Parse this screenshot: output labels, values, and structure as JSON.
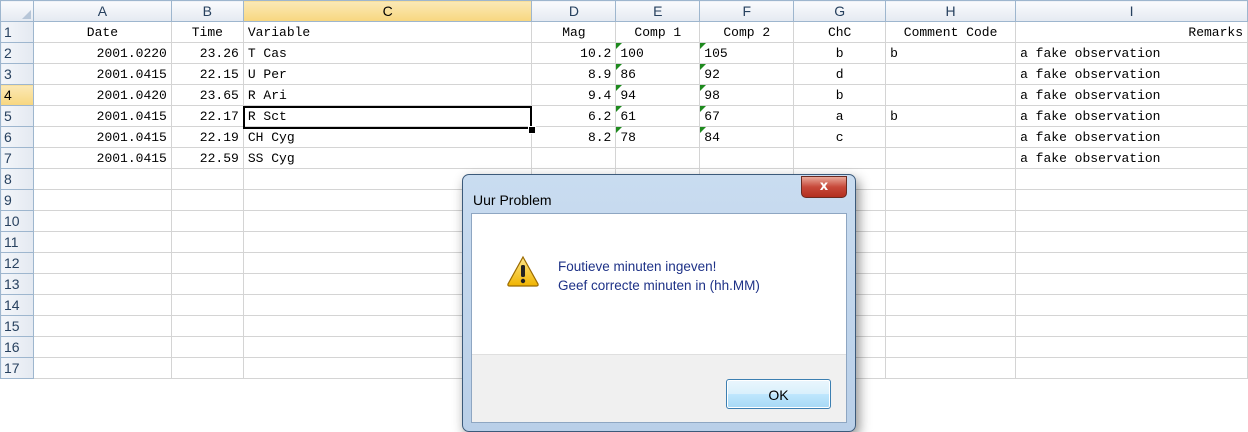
{
  "spreadsheet": {
    "column_letters": [
      "A",
      "B",
      "C",
      "D",
      "E",
      "F",
      "G",
      "H",
      "I"
    ],
    "row_numbers": [
      "1",
      "2",
      "3",
      "4",
      "5",
      "6",
      "7",
      "8",
      "9",
      "10",
      "11",
      "12",
      "13",
      "14",
      "15",
      "16",
      "17"
    ],
    "headers": [
      "Date",
      "Time",
      "Variable",
      "Mag",
      "Comp 1",
      "Comp 2",
      "ChC",
      "Comment Code",
      "Remarks"
    ],
    "rows": [
      [
        "2001.0220",
        "23.26",
        "T Cas",
        "10.2",
        "100",
        "105",
        "b",
        "b",
        "a fake observation"
      ],
      [
        "2001.0415",
        "22.15",
        "U Per",
        "8.9",
        "86",
        "92",
        "d",
        "",
        "a fake observation"
      ],
      [
        "2001.0420",
        "23.65",
        "R Ari",
        "9.4",
        "94",
        "98",
        "b",
        "",
        "a fake observation"
      ],
      [
        "2001.0415",
        "22.17",
        "R Sct",
        "6.2",
        "61",
        "67",
        "a",
        "b",
        "a fake observation"
      ],
      [
        "2001.0415",
        "22.19",
        "CH Cyg",
        "8.2",
        "78",
        "84",
        "c",
        "",
        "a fake observation"
      ],
      [
        "2001.0415",
        "22.59",
        "SS Cyg",
        "",
        "",
        "",
        "",
        "",
        "a fake observation"
      ]
    ],
    "active_column": "C",
    "active_row": "4"
  },
  "dialog": {
    "title": "Uur Problem",
    "close_label": "x",
    "message_line1": "Foutieve minuten ingeven!",
    "message_line2": "Geef correcte minuten in (hh.MM)",
    "ok_label": "OK",
    "icon": "warning-icon"
  },
  "colors": {
    "header_bg": "#e4e9f1",
    "active_header_bg": "#f7d67f",
    "dialog_frame": "#b9cfe8",
    "close_button": "#c7493a",
    "error_indicator": "#1e8a1e"
  }
}
